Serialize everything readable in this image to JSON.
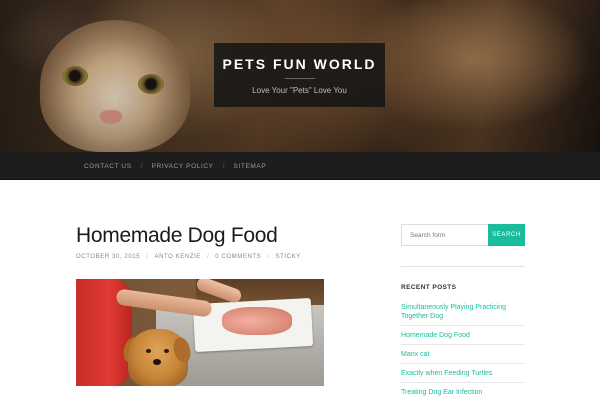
{
  "header": {
    "site_title": "PETS FUN WORLD",
    "tagline": "Love Your \"Pets\" Love You"
  },
  "nav": {
    "items": [
      {
        "label": "CONTACT US"
      },
      {
        "label": "PRIVACY POLICY"
      },
      {
        "label": "SITEMAP"
      }
    ],
    "separator": "/"
  },
  "post": {
    "title": "Homemade Dog Food",
    "meta": {
      "date": "OCTOBER 30, 2015",
      "author": "ANTO KENZIE",
      "comments": "0 COMMENTS",
      "tag": "STICKY",
      "separator": "/"
    }
  },
  "sidebar": {
    "search": {
      "placeholder": "Search form",
      "button_label": "SEARCH"
    },
    "recent_posts": {
      "title": "RECENT POSTS",
      "items": [
        {
          "label": "Simultaneously Playing Practicing Together Dog"
        },
        {
          "label": "Homemade Dog Food"
        },
        {
          "label": "Manx cat"
        },
        {
          "label": "Exactly when Feeding Turtles"
        },
        {
          "label": "Treating Dog Ear Infection"
        }
      ]
    }
  },
  "colors": {
    "accent": "#1abc9c",
    "navbar": "#1d1d1d",
    "title_box": "#141414"
  }
}
